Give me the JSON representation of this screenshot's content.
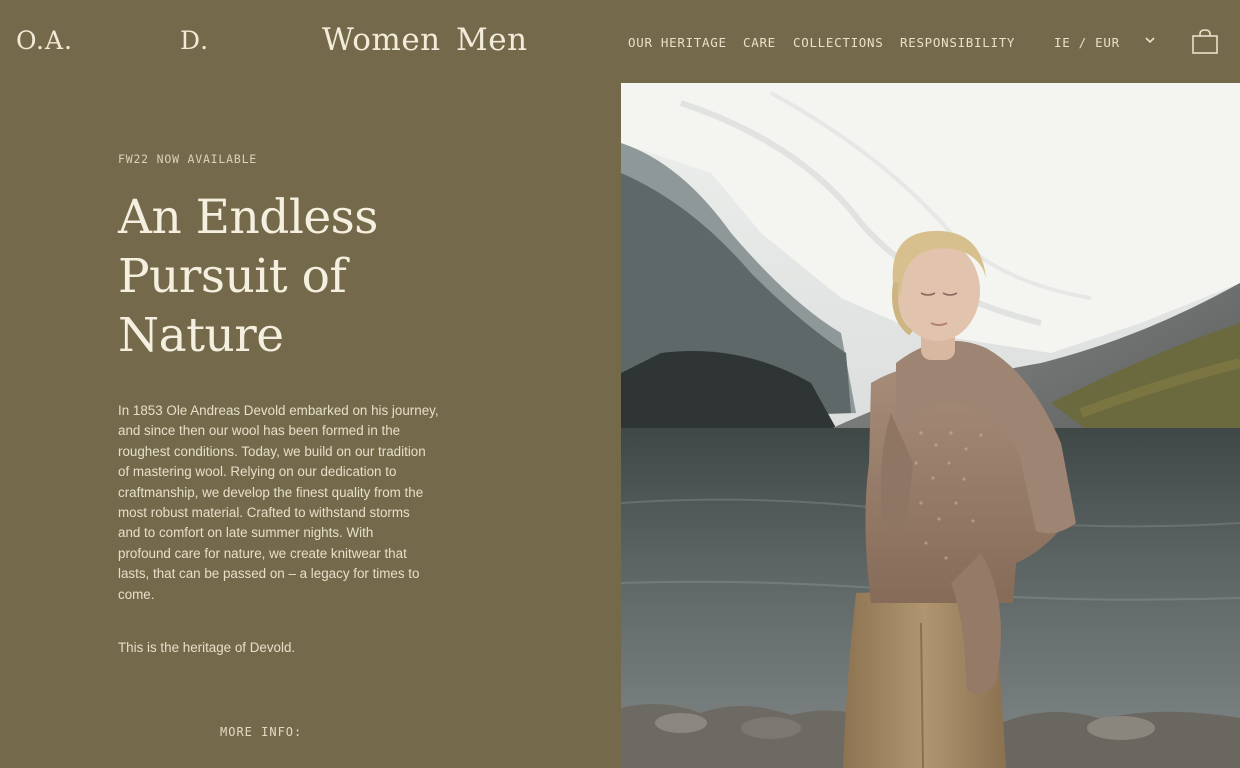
{
  "header": {
    "logo_left": "O.A.",
    "logo_right": "D.",
    "gender_women": "Women",
    "gender_men": "Men",
    "nav": [
      "OUR HERITAGE",
      "CARE",
      "COLLECTIONS",
      "RESPONSIBILITY"
    ],
    "locale": "IE / EUR",
    "icons": {
      "locale_toggle": "chevron-down-icon",
      "cart": "shopping-bag-icon"
    }
  },
  "hero": {
    "eyebrow": "FW22 NOW AVAILABLE",
    "headline_lines": [
      "An Endless",
      "Pursuit of",
      "Nature"
    ],
    "body_lines": [
      "In 1853 Ole Andreas Devold embarked on his journey,",
      "and since then our wool has been formed in the",
      "roughest conditions. Today, we build on our tradition",
      "of mastering wool. Relying on our dedication to",
      "craftmanship, we develop the finest quality from the",
      "most robust material. Crafted to withstand storms",
      "and to comfort on late summer nights. With",
      "profound care for nature, we create knitwear that",
      "lasts, that can be passed on – a legacy for times to",
      "come."
    ],
    "heritage": "This is the heritage of Devold.",
    "more_info": "MORE INFO:"
  },
  "colors": {
    "background": "#746a4b",
    "text": "#efe8d6"
  }
}
